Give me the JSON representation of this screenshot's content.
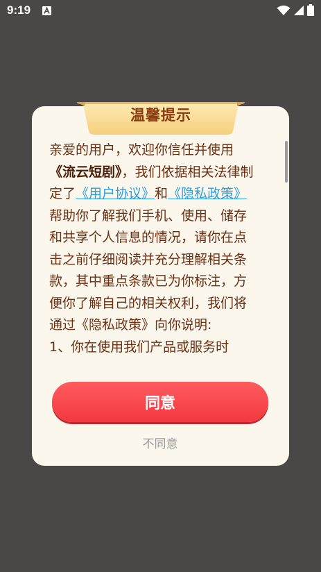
{
  "status_bar": {
    "time": "9:19",
    "icons": [
      "a-notification-icon",
      "wifi-icon",
      "signal-icon",
      "battery-icon"
    ]
  },
  "dialog": {
    "title": "温馨提示",
    "body": {
      "p1": "亲爱的用户，欢迎你信任并使用",
      "app_name": "《流云短剧》",
      "p2": "，我们依据相关法律制定了",
      "link_user_agreement": "《用户协议》",
      "and": "和",
      "link_privacy_policy": "《隐私政策》",
      "p3": "帮助你了解我们手机、使用、储存和共享个人信息的情况，请你在点击之前仔细阅读并充分理解相关条款，其中重点条款已为你标注，方便你了解自己的相关权利，我们将通过《隐私政策》向你说明:",
      "list_item_1": "1、你在使用我们产品或服务时"
    },
    "agree_label": "同意",
    "disagree_label": "不同意"
  },
  "colors": {
    "overlay": "#4a4846",
    "dialog_bg": "#fbf7ec",
    "text": "#6b2f14",
    "title": "#8a3b10",
    "link": "#2a9fe0",
    "primary_button": "#f2383f",
    "secondary_text": "#9a9a9a"
  }
}
